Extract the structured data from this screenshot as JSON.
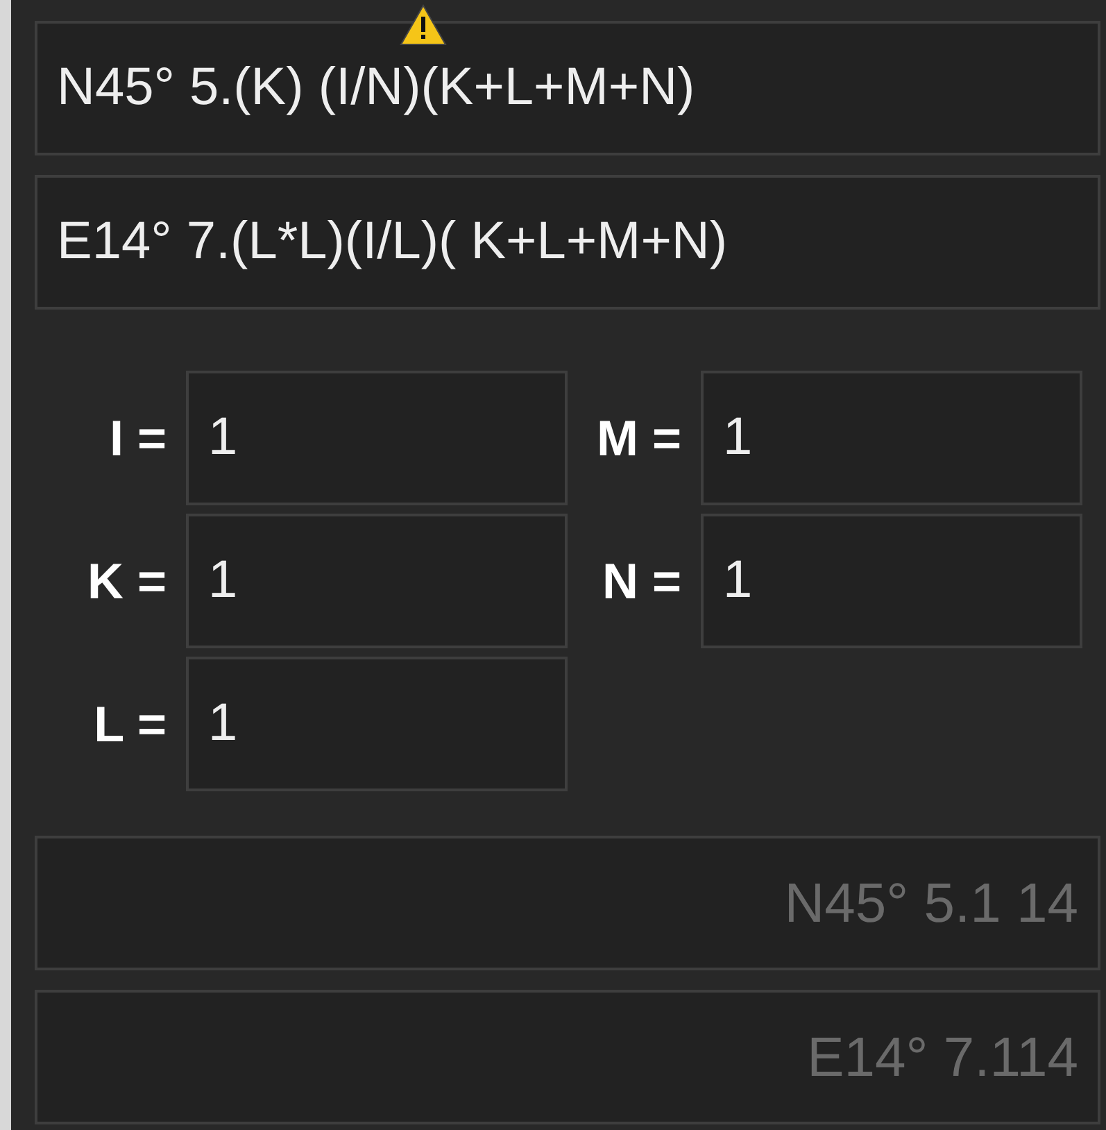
{
  "formulas": [
    {
      "value": "N45° 5.(K) (I/N)(K+L+M+N)",
      "warning": true
    },
    {
      "value": "E14° 7.(L*L)(I/L)( K+L+M+N)",
      "warning": false
    }
  ],
  "variable_columns": [
    [
      {
        "name": "I =",
        "value": "1"
      },
      {
        "name": "K =",
        "value": "1"
      },
      {
        "name": "L =",
        "value": "1"
      }
    ],
    [
      {
        "name": "M =",
        "value": "1"
      },
      {
        "name": "N =",
        "value": "1"
      }
    ]
  ],
  "results": [
    "N45° 5.1 14",
    "E14° 7.114"
  ]
}
